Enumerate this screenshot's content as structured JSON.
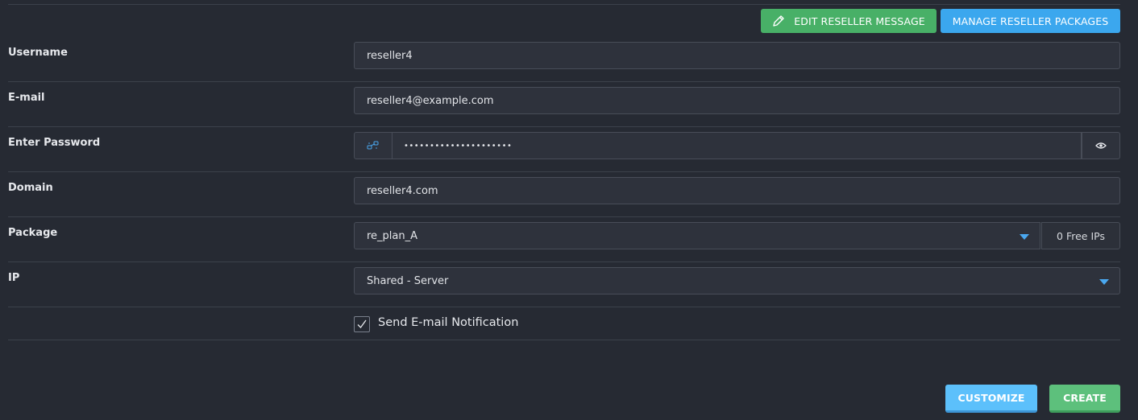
{
  "toolbar": {
    "edit_message_label": "EDIT RESELLER MESSAGE",
    "manage_packages_label": "MANAGE RESELLER PACKAGES"
  },
  "form": {
    "username": {
      "label": "Username",
      "value": "reseller4"
    },
    "email": {
      "label": "E-mail",
      "value": "reseller4@example.com"
    },
    "password": {
      "label": "Enter Password",
      "value": "•••••••••••••••••••••"
    },
    "domain": {
      "label": "Domain",
      "value": "reseller4.com"
    },
    "package": {
      "label": "Package",
      "value": "re_plan_A",
      "free_ips": "0 Free IPs"
    },
    "ip": {
      "label": "IP",
      "value": "Shared - Server"
    },
    "notification": {
      "label": "Send E-mail Notification",
      "checked": true
    }
  },
  "actions": {
    "customize_label": "CUSTOMIZE",
    "create_label": "CREATE"
  },
  "colors": {
    "background": "#262a33",
    "field_bg": "#2e323c",
    "green": "#48b067",
    "blue": "#3ba7ee",
    "caret": "#4aa8f0"
  },
  "icons": {
    "edit": "pencil-icon",
    "generate": "generate-password-icon",
    "toggle_visibility": "eye-icon",
    "dropdown": "caret-down-icon",
    "checkbox": "check-icon"
  }
}
